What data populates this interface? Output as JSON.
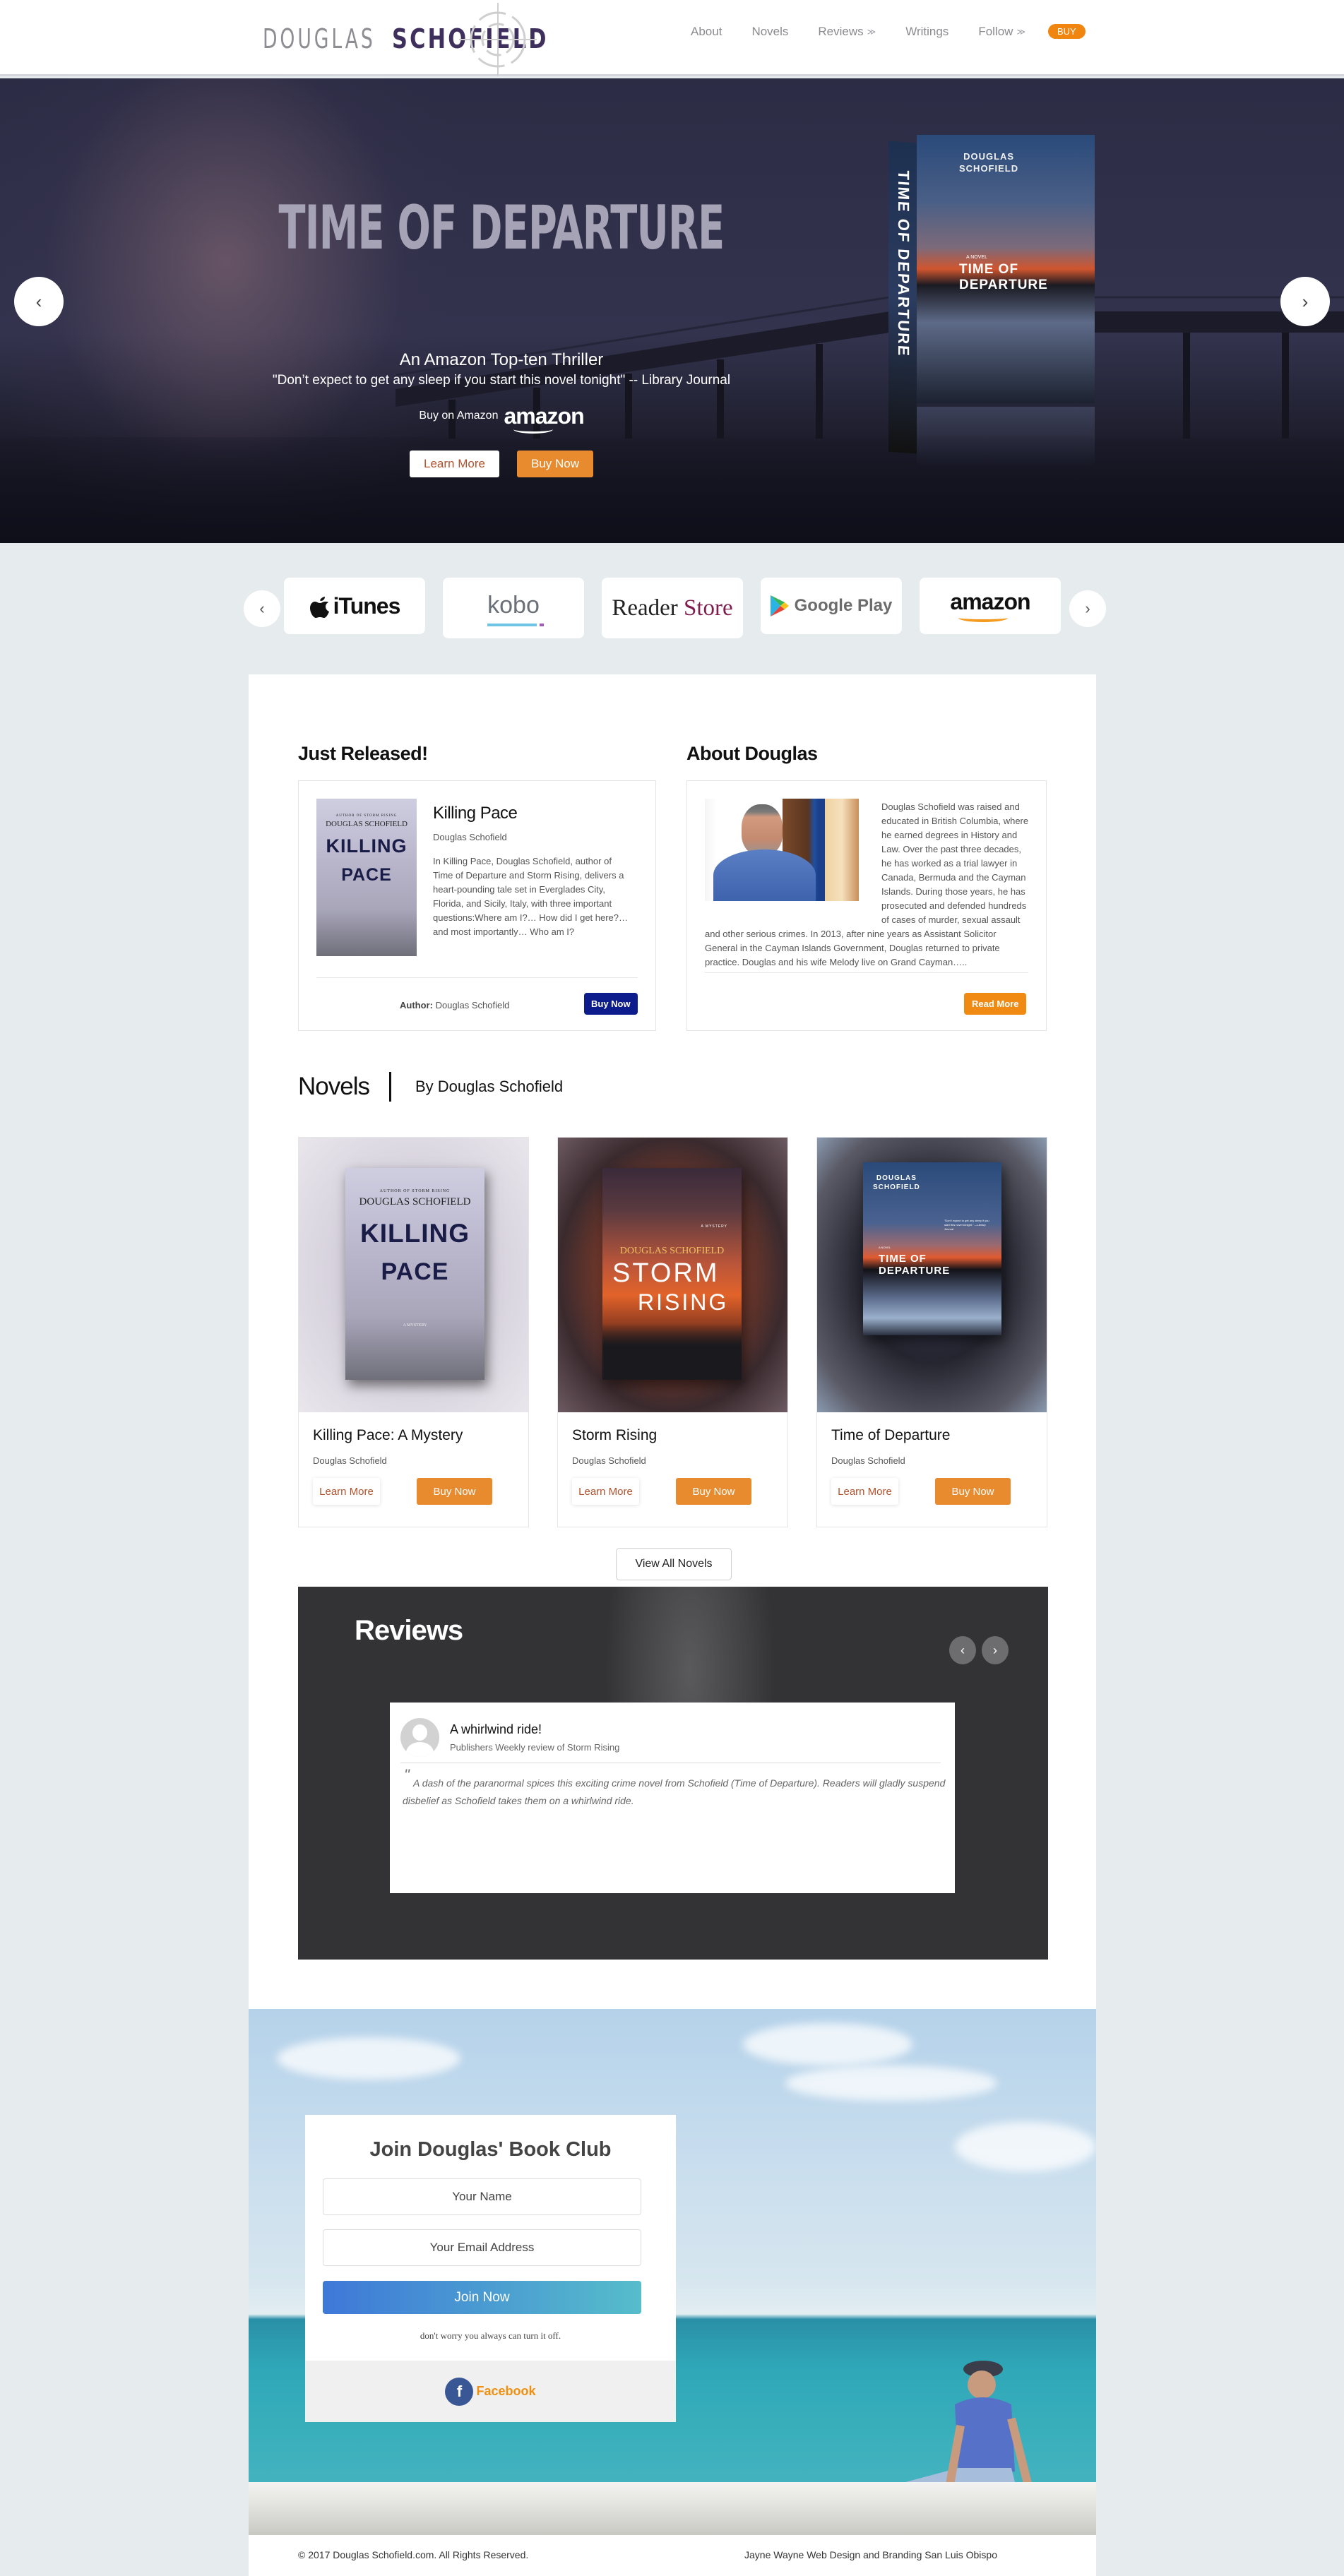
{
  "header": {
    "logo_first": "DOUGLAS",
    "logo_last": "SCHOFIELD",
    "nav": [
      {
        "label": "About",
        "dropdown": false
      },
      {
        "label": "Novels",
        "dropdown": false
      },
      {
        "label": "Reviews",
        "dropdown": true
      },
      {
        "label": "Writings",
        "dropdown": false
      },
      {
        "label": "Follow",
        "dropdown": true
      }
    ],
    "buy_label": "BUY",
    "dropdown_glyph": "≫"
  },
  "hero": {
    "title": "TIME OF DEPARTURE",
    "subtitle": "An Amazon Top-ten Thriller",
    "quote": "\"Don’t expect to get any sleep if you start this novel tonight\" -- Library Journal",
    "buy_on": "Buy on Amazon",
    "amazon_logo": "amazon",
    "learn_more": "Learn More",
    "buy_now": "Buy Now",
    "prev_glyph": "‹",
    "next_glyph": "›",
    "book_author_line1": "DOUGLAS",
    "book_author_line2": "SCHOFIELD",
    "book_kicker": "A NOVEL",
    "book_title": "TIME OF DEPARTURE",
    "book_spine": "TIME OF DEPARTURE"
  },
  "retailers": {
    "prev_glyph": "‹",
    "next_glyph": "›",
    "items": [
      {
        "name": "iTunes",
        "apple_glyph": ""
      },
      {
        "name": "kobo"
      },
      {
        "name_a": "Reader",
        "name_b": "Store"
      },
      {
        "name": "Google Play"
      },
      {
        "name": "amazon"
      }
    ]
  },
  "just_released": {
    "heading": "Just Released!",
    "cover_kicker": "AUTHOR OF STORM RISING",
    "cover_author": "DOUGLAS SCHOFIELD",
    "cover_title_1": "KILLING",
    "cover_title_2": "PACE",
    "title": "Killing Pace",
    "author": "Douglas Schofield",
    "description": "In Killing Pace, Douglas Schofield, author of Time of Departure and Storm Rising, delivers a heart-pounding tale set in Everglades City, Florida, and Sicily, Italy, with three important questions:Where am I?… How did I get here?… and most importantly… Who am I?",
    "author_label": "Author:",
    "author_value": "Douglas Schofield",
    "buy_now": "Buy Now",
    "accent": "#0d1c8c"
  },
  "about": {
    "heading": "About Douglas",
    "bio": "Douglas Schofield was raised and educated in British Columbia, where he earned degrees in History and Law. Over the past three decades, he has worked as a trial lawyer in Canada, Bermuda and the Cayman Islands. During those years, he has prosecuted and defended hundreds of cases of murder, sexual assault and other serious crimes. In 2013, after nine years as Assistant Solicitor General in the Cayman Islands Government, Douglas returned to private practice. Douglas and his wife Melody live on Grand Cayman…..",
    "read_more": "Read More"
  },
  "novels": {
    "heading": "Novels",
    "subheading": "By Douglas Schofield",
    "items": [
      {
        "title": "Killing Pace: A Mystery",
        "author": "Douglas Schofield",
        "learn_more": "Learn More",
        "buy_now": "Buy Now",
        "cover": {
          "kicker": "AUTHOR OF STORM RISING",
          "author": "DOUGLAS SCHOFIELD",
          "t1": "KILLING",
          "t2": "PACE",
          "tag": "A MYSTERY"
        }
      },
      {
        "title": "Storm Rising",
        "author": "Douglas Schofield",
        "learn_more": "Learn More",
        "buy_now": "Buy Now",
        "cover": {
          "kicker": "A MYSTERY",
          "author": "DOUGLAS SCHOFIELD",
          "t1": "STORM",
          "t2": "RISING"
        }
      },
      {
        "title": "Time of Departure",
        "author": "Douglas Schofield",
        "learn_more": "Learn More",
        "buy_now": "Buy Now",
        "cover": {
          "author1": "DOUGLAS",
          "author2": "SCHOFIELD",
          "quote": "\"Don't expect to get any sleep if you start this novel tonight.\" —Library Journal",
          "kicker": "A NOVEL",
          "t1": "TIME OF DEPARTURE"
        }
      }
    ],
    "view_all": "View All Novels"
  },
  "reviews": {
    "heading": "Reviews",
    "prev_glyph": "‹",
    "next_glyph": "›",
    "items": [
      {
        "title": "A whirlwind ride!",
        "source": "Publishers Weekly review of Storm Rising",
        "text": "A dash of the paranormal spices this exciting crime novel from Schofield (Time of Departure). Readers will gladly suspend disbelief as Schofield takes them on a whirlwind ride."
      }
    ],
    "quote_mark": "\""
  },
  "book_club": {
    "heading": "Join Douglas' Book Club",
    "name_placeholder": "Your Name",
    "email_placeholder": "Your Email Address",
    "join": "Join Now",
    "note": "don't worry you always can turn it off.",
    "facebook_glyph": "f",
    "facebook": "Facebook"
  },
  "footer": {
    "copyright": "© 2017 Douglas Schofield.com. All Rights Reserved.",
    "credit": "Jayne Wayne Web Design and Branding San Luis Obispo"
  },
  "colors": {
    "accent_orange": "#e88a2e",
    "buy_pill": "#f0860f",
    "navy": "#0d1c8c",
    "page_bg": "#e6ebee",
    "logo_purple": "#3e2f5c",
    "facebook": "#3a5795"
  }
}
